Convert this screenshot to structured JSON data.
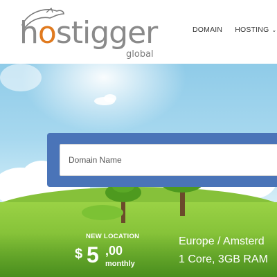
{
  "brand": {
    "name_a": "h",
    "name_o": "o",
    "name_b": "stigger",
    "sub": "global"
  },
  "nav": {
    "items": [
      {
        "label": "DOMAIN"
      },
      {
        "label": "HOSTING",
        "chevron": "⌄"
      }
    ]
  },
  "search": {
    "placeholder": "Domain Name",
    "value": ""
  },
  "offer": {
    "badge": "NEW LOCATION",
    "currency": "$",
    "price_main": "5",
    "price_cents": ",00",
    "period": "monthly",
    "location": "Europe / Amsterd",
    "specs": "1 Core, 3GB RAM"
  },
  "colors": {
    "brand_orange": "#e07a1f",
    "brand_gray": "#8a8a8a",
    "search_blue": "#4a74b8",
    "grass_green": "#86c13a"
  }
}
